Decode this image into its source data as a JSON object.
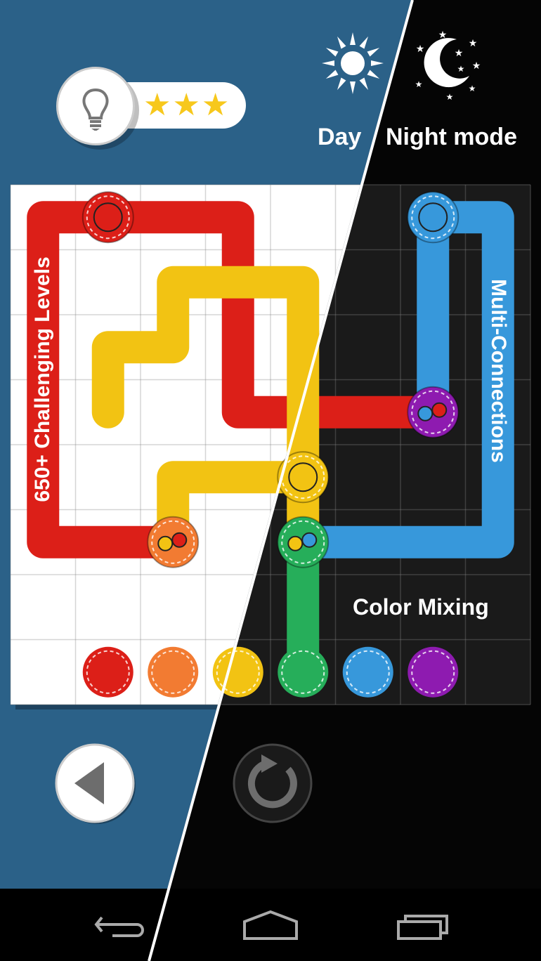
{
  "header": {
    "hint_icon": "lightbulb-icon",
    "stars_earned": 3,
    "stars_total": 3,
    "stars_text": "★★★",
    "day_icon": "sun-icon",
    "night_icon": "moon-stars-icon",
    "day_label": "Day",
    "night_label": "Night mode"
  },
  "promo": {
    "levels": "650+ Challenging Levels",
    "multi": "Multi-Connections",
    "mixing": "Color Mixing"
  },
  "colors": {
    "day_bg": "#2b6188",
    "night_bg": "#000000",
    "red": "#dc1f18",
    "orange": "#f27b32",
    "yellow": "#f2c313",
    "green": "#26ae5a",
    "blue": "#3798db",
    "purple": "#8e1bb0"
  },
  "board": {
    "cols": 8,
    "rows": 8,
    "pipes": [
      {
        "color": "red",
        "cells": [
          [
            1,
            0
          ],
          [
            0,
            0
          ],
          [
            0,
            5
          ],
          [
            2,
            5
          ]
        ]
      },
      {
        "color": "red",
        "cells": [
          [
            1,
            0
          ],
          [
            3,
            0
          ],
          [
            3,
            3
          ],
          [
            6,
            3
          ]
        ]
      },
      {
        "color": "yellow",
        "cells": [
          [
            1,
            3
          ],
          [
            1,
            2
          ],
          [
            2,
            2
          ],
          [
            2,
            1
          ],
          [
            4,
            1
          ],
          [
            4,
            5
          ]
        ]
      },
      {
        "color": "yellow",
        "cells": [
          [
            4,
            4
          ],
          [
            2,
            4
          ],
          [
            2,
            5
          ]
        ]
      },
      {
        "color": "blue",
        "cells": [
          [
            6,
            0
          ],
          [
            7,
            0
          ],
          [
            7,
            5
          ],
          [
            4,
            5
          ]
        ]
      },
      {
        "color": "blue",
        "cells": [
          [
            6,
            0
          ],
          [
            6,
            3
          ]
        ]
      },
      {
        "color": "green",
        "cells": [
          [
            4,
            5
          ],
          [
            4,
            7
          ]
        ]
      }
    ],
    "endpoints": [
      {
        "color": "red",
        "cell": [
          1,
          0
        ]
      },
      {
        "color": "blue",
        "cell": [
          6,
          0
        ]
      },
      {
        "color": "purple",
        "cell": [
          6,
          3
        ],
        "mix": [
          "blue",
          "red"
        ]
      },
      {
        "color": "yellow",
        "cell": [
          4,
          4
        ]
      },
      {
        "color": "orange",
        "cell": [
          2,
          5
        ],
        "mix": [
          "yellow",
          "red"
        ]
      },
      {
        "color": "green",
        "cell": [
          4,
          5
        ],
        "mix": [
          "yellow",
          "blue"
        ]
      }
    ],
    "palette": [
      "red",
      "orange",
      "yellow",
      "green",
      "blue",
      "purple"
    ]
  },
  "controls": {
    "back_icon": "back-triangle-icon",
    "restart_icon": "restart-icon"
  },
  "navbar": {
    "back": "nav-back-icon",
    "home": "nav-home-icon",
    "recents": "nav-recents-icon"
  }
}
